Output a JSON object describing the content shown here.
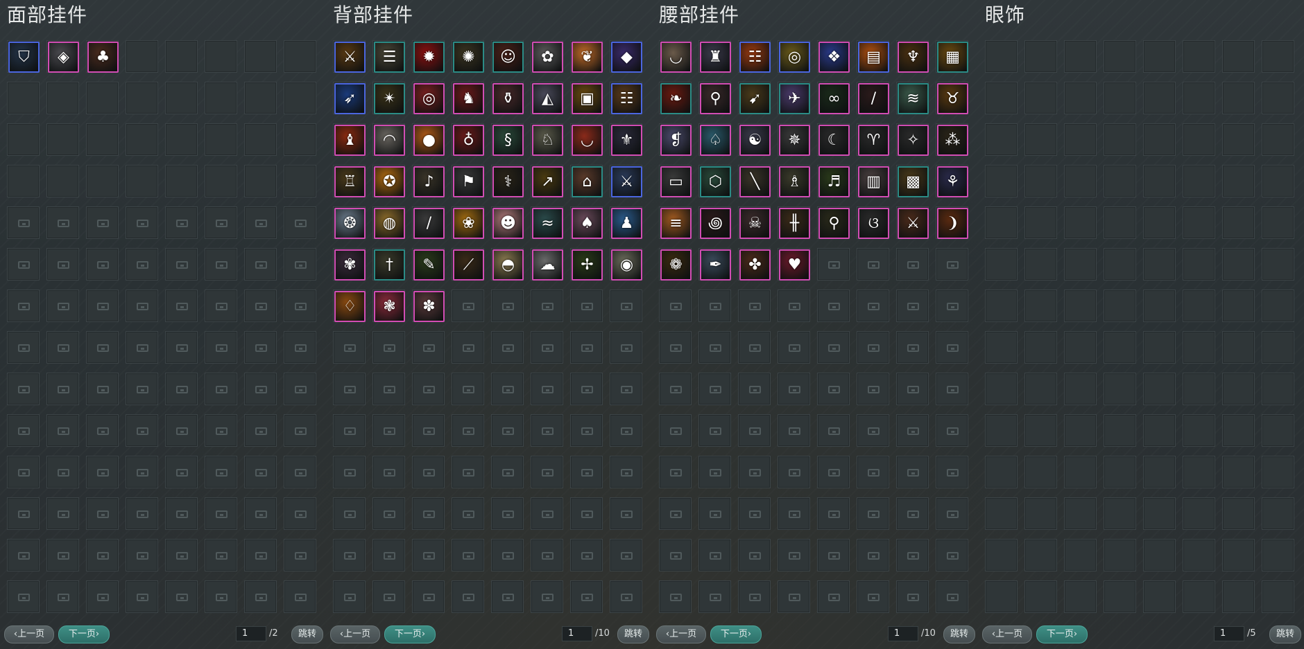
{
  "panels": [
    {
      "title": "面部挂件",
      "icons": [
        {
          "name": "face-mask-icon",
          "glyph": "⛉",
          "bg": "#243448",
          "border": "blue"
        },
        {
          "name": "face-shield-icon",
          "glyph": "◈",
          "bg": "#4a4a4f",
          "border": "pink"
        },
        {
          "name": "face-mushroom-icon",
          "glyph": "♣",
          "bg": "#4a2b1e",
          "border": "pink"
        }
      ],
      "empty_unlocked": 29,
      "prev_label": "上一页",
      "next_label": "下一页",
      "page_value": "1",
      "page_total": "/2",
      "jump_label": "跳转"
    },
    {
      "title": "背部挂件",
      "icons": [
        {
          "name": "golden-sword-icon",
          "glyph": "⚔",
          "bg": "#5a3a12",
          "border": "blue"
        },
        {
          "name": "scroll-icon",
          "glyph": "☰",
          "bg": "#4a4636",
          "border": "teal"
        },
        {
          "name": "red-flame-icon",
          "glyph": "✹",
          "bg": "#8a1010",
          "border": "teal"
        },
        {
          "name": "golden-web-icon",
          "glyph": "✺",
          "bg": "#3a3420",
          "border": "teal"
        },
        {
          "name": "doll-icon",
          "glyph": "☺",
          "bg": "#4a2018",
          "border": "teal"
        },
        {
          "name": "white-flower-icon",
          "glyph": "✿",
          "bg": "#5a5a5a",
          "border": "pink"
        },
        {
          "name": "butterfly-icon",
          "glyph": "❦",
          "bg": "#c06a28",
          "border": "pink"
        },
        {
          "name": "purple-crystal-icon",
          "glyph": "◆",
          "bg": "#3a2a6a",
          "border": "blue"
        },
        {
          "name": "blue-spear-icon",
          "glyph": "➶",
          "bg": "#1a3a7a",
          "border": "blue"
        },
        {
          "name": "bronze-wheel-icon",
          "glyph": "✴",
          "bg": "#3a3218",
          "border": "teal"
        },
        {
          "name": "red-lantern-icon",
          "glyph": "◎",
          "bg": "#7a2020",
          "border": "pink"
        },
        {
          "name": "red-bird-icon",
          "glyph": "♞",
          "bg": "#6a1a1a",
          "border": "pink"
        },
        {
          "name": "jade-vase-icon",
          "glyph": "⚱",
          "bg": "#4a2a2a",
          "border": "pink"
        },
        {
          "name": "silver-wolf-icon",
          "glyph": "◭",
          "bg": "#4a4a5a",
          "border": "pink"
        },
        {
          "name": "golden-chest-icon",
          "glyph": "▣",
          "bg": "#6a4a10",
          "border": "pink"
        },
        {
          "name": "books-icon",
          "glyph": "☷",
          "bg": "#5a3a1a",
          "border": "blue"
        },
        {
          "name": "parrot-icon",
          "glyph": "♝",
          "bg": "#8a2a10",
          "border": "pink"
        },
        {
          "name": "white-fan-icon",
          "glyph": "◠",
          "bg": "#6a6660",
          "border": "pink"
        },
        {
          "name": "orange-orb-icon",
          "glyph": "●",
          "bg": "#b05a18",
          "border": "pink"
        },
        {
          "name": "red-gourd-icon",
          "glyph": "♁",
          "bg": "#6a1a1a",
          "border": "pink"
        },
        {
          "name": "green-dragon-icon",
          "glyph": "§",
          "bg": "#2a4a3a",
          "border": "pink"
        },
        {
          "name": "white-bird-icon",
          "glyph": "♘",
          "bg": "#5a5a4a",
          "border": "pink"
        },
        {
          "name": "red-fan-icon",
          "glyph": "◡",
          "bg": "#8a2a1a",
          "border": "pink"
        },
        {
          "name": "silver-wings-icon",
          "glyph": "⚜",
          "bg": "#2a2a3a",
          "border": "pink"
        },
        {
          "name": "bird-cage-icon",
          "glyph": "♖",
          "bg": "#4a3a1a",
          "border": "pink"
        },
        {
          "name": "golden-star-icon",
          "glyph": "✪",
          "bg": "#b06a10",
          "border": "pink"
        },
        {
          "name": "wind-chime-icon",
          "glyph": "♪",
          "bg": "#3a3428",
          "border": "pink"
        },
        {
          "name": "white-banner-icon",
          "glyph": "⚑",
          "bg": "#3a3a3a",
          "border": "pink"
        },
        {
          "name": "golden-staff-icon",
          "glyph": "⚕",
          "bg": "#2a2418",
          "border": "pink"
        },
        {
          "name": "golden-spear-icon",
          "glyph": "↗",
          "bg": "#4a3a10",
          "border": "pink"
        },
        {
          "name": "pavilion-icon",
          "glyph": "⌂",
          "bg": "#5a3a2a",
          "border": "teal"
        },
        {
          "name": "blue-sword-icon",
          "glyph": "⚔",
          "bg": "#2a3a5a",
          "border": "blue"
        },
        {
          "name": "silver-pendant-icon",
          "glyph": "❂",
          "bg": "#6a7a8a",
          "border": "pink"
        },
        {
          "name": "golden-ring-icon",
          "glyph": "◍",
          "bg": "#8a6a2a",
          "border": "pink"
        },
        {
          "name": "silver-blade-icon",
          "glyph": "/",
          "bg": "#3a3a3a",
          "border": "pink"
        },
        {
          "name": "golden-lotus-icon",
          "glyph": "❀",
          "bg": "#a06a10",
          "border": "pink"
        },
        {
          "name": "pink-girl-icon",
          "glyph": "☻",
          "bg": "#b07a7a",
          "border": "pink"
        },
        {
          "name": "teal-fish-icon",
          "glyph": "≈",
          "bg": "#2a4a4a",
          "border": "pink"
        },
        {
          "name": "pink-crane-icon",
          "glyph": "♠",
          "bg": "#6a4a5a",
          "border": "pink"
        },
        {
          "name": "penguin-icon",
          "glyph": "♟",
          "bg": "#2a5a8a",
          "border": "pink"
        },
        {
          "name": "pink-blossom-icon",
          "glyph": "✾",
          "bg": "#3a2a3a",
          "border": "pink"
        },
        {
          "name": "golden-scepter-icon",
          "glyph": "†",
          "bg": "#3a3a2a",
          "border": "teal"
        },
        {
          "name": "talisman-icon",
          "glyph": "✎",
          "bg": "#2a3a1a",
          "border": "pink"
        },
        {
          "name": "golden-rod-icon",
          "glyph": "⟋",
          "bg": "#3a2a18",
          "border": "pink"
        },
        {
          "name": "straw-hat-icon",
          "glyph": "◓",
          "bg": "#8a7a50",
          "border": "pink"
        },
        {
          "name": "silver-cloud-icon",
          "glyph": "☁",
          "bg": "#6a6a6a",
          "border": "pink"
        },
        {
          "name": "golden-branch-icon",
          "glyph": "✢",
          "bg": "#2a3a18",
          "border": "pink"
        },
        {
          "name": "golden-mirror-icon",
          "glyph": "◉",
          "bg": "#6a6a5a",
          "border": "pink"
        },
        {
          "name": "amber-bottle-icon",
          "glyph": "♢",
          "bg": "#8a4a10",
          "border": "pink"
        },
        {
          "name": "ruby-orb-icon",
          "glyph": "❃",
          "bg": "#8a2a3a",
          "border": "pink"
        },
        {
          "name": "pink-fan-icon",
          "glyph": "✽",
          "bg": "#5a3a3a",
          "border": "pink"
        }
      ],
      "empty_unlocked": 0,
      "prev_label": "上一页",
      "next_label": "下一页",
      "page_value": "1",
      "page_total": "/10",
      "jump_label": "跳转"
    },
    {
      "title": "腰部挂件",
      "icons": [
        {
          "name": "paper-fan-icon",
          "glyph": "◡",
          "bg": "#6a5a4a",
          "border": "pink"
        },
        {
          "name": "silver-armor-icon",
          "glyph": "♜",
          "bg": "#3a3a4a",
          "border": "pink"
        },
        {
          "name": "firecracker-icon",
          "glyph": "☷",
          "bg": "#9a3a10",
          "border": "blue"
        },
        {
          "name": "gold-coins-icon",
          "glyph": "◎",
          "bg": "#6a5a1a",
          "border": "blue"
        },
        {
          "name": "blue-wing-icon",
          "glyph": "❖",
          "bg": "#2a3a8a",
          "border": "pink"
        },
        {
          "name": "red-drum-icon",
          "glyph": "▤",
          "bg": "#b05010",
          "border": "blue"
        },
        {
          "name": "golden-candle-icon",
          "glyph": "♆",
          "bg": "#4a3010",
          "border": "pink"
        },
        {
          "name": "golden-basket-icon",
          "glyph": "▦",
          "bg": "#6a4a10",
          "border": "teal"
        },
        {
          "name": "red-cape-icon",
          "glyph": "❧",
          "bg": "#6a1a10",
          "border": "teal"
        },
        {
          "name": "silver-hook-icon",
          "glyph": "⚲",
          "bg": "#3a2a2a",
          "border": "pink"
        },
        {
          "name": "bronze-horn-icon",
          "glyph": "➹",
          "bg": "#4a3a1a",
          "border": "teal"
        },
        {
          "name": "purple-blade-icon",
          "glyph": "✈",
          "bg": "#4a3a6a",
          "border": "teal"
        },
        {
          "name": "green-beads-icon",
          "glyph": "∞",
          "bg": "#1a2a1a",
          "border": "pink"
        },
        {
          "name": "red-dagger-icon",
          "glyph": "/",
          "bg": "#2a1a1a",
          "border": "pink"
        },
        {
          "name": "jade-scroll-icon",
          "glyph": "≋",
          "bg": "#3a5a4a",
          "border": "teal"
        },
        {
          "name": "golden-dragon-icon",
          "glyph": "♉",
          "bg": "#5a3a10",
          "border": "pink"
        },
        {
          "name": "purple-rabbit-icon",
          "glyph": "❡",
          "bg": "#4a4a6a",
          "border": "pink"
        },
        {
          "name": "teal-pouch-icon",
          "glyph": "♤",
          "bg": "#2a5a6a",
          "border": "pink"
        },
        {
          "name": "silver-mask-icon",
          "glyph": "☯",
          "bg": "#3a3a4a",
          "border": "pink"
        },
        {
          "name": "dark-pearl-icon",
          "glyph": "✵",
          "bg": "#3a3a3a",
          "border": "pink"
        },
        {
          "name": "moon-pendant-icon",
          "glyph": "☾",
          "bg": "#2a2a2a",
          "border": "pink"
        },
        {
          "name": "golden-goat-icon",
          "glyph": "♈",
          "bg": "#2a2a2a",
          "border": "pink"
        },
        {
          "name": "white-feather-icon",
          "glyph": "✧",
          "bg": "#2a2a2a",
          "border": "pink"
        },
        {
          "name": "golden-tassel-icon",
          "glyph": "⁂",
          "bg": "#2a2418",
          "border": "pink"
        },
        {
          "name": "white-tag-icon",
          "glyph": "▭",
          "bg": "#3a3a3a",
          "border": "pink"
        },
        {
          "name": "green-lantern-icon",
          "glyph": "⬡",
          "bg": "#2a4a3a",
          "border": "teal"
        },
        {
          "name": "bronze-stick-icon",
          "glyph": "╲",
          "bg": "#3a3428",
          "border": "pink"
        },
        {
          "name": "stone-lamp-icon",
          "glyph": "♗",
          "bg": "#3a3a2a",
          "border": "pink"
        },
        {
          "name": "green-wind-chime-icon",
          "glyph": "♬",
          "bg": "#2a3a1a",
          "border": "pink"
        },
        {
          "name": "gray-drum-icon",
          "glyph": "▥",
          "bg": "#4a4040",
          "border": "pink"
        },
        {
          "name": "red-basket-icon",
          "glyph": "▩",
          "bg": "#4a3a1a",
          "border": "teal"
        },
        {
          "name": "blue-charm-icon",
          "glyph": "⚘",
          "bg": "#2a2a4a",
          "border": "pink"
        },
        {
          "name": "orange-cloth-icon",
          "glyph": "≡",
          "bg": "#a05a20",
          "border": "pink"
        },
        {
          "name": "black-swirl-icon",
          "glyph": "꩜",
          "bg": "#2a1a1a",
          "border": "pink"
        },
        {
          "name": "skull-bell-icon",
          "glyph": "☠",
          "bg": "#3a2a2a",
          "border": "pink"
        },
        {
          "name": "wooden-rack-icon",
          "glyph": "╫",
          "bg": "#3a2a18",
          "border": "pink"
        },
        {
          "name": "hanging-charm-icon",
          "glyph": "⚲",
          "bg": "#2a2a1a",
          "border": "pink"
        },
        {
          "name": "silver-snake-icon",
          "glyph": "ଓ",
          "bg": "#2a2a2a",
          "border": "pink"
        },
        {
          "name": "red-sword-icon",
          "glyph": "⚔",
          "bg": "#4a2a1a",
          "border": "pink"
        },
        {
          "name": "orange-shrimp-icon",
          "glyph": "❩",
          "bg": "#5a2a10",
          "border": "pink"
        },
        {
          "name": "golden-wreath-icon",
          "glyph": "❁",
          "bg": "#3a2a10",
          "border": "pink"
        },
        {
          "name": "silver-quill-icon",
          "glyph": "✒",
          "bg": "#3a4a5a",
          "border": "pink"
        },
        {
          "name": "red-bells-icon",
          "glyph": "✤",
          "bg": "#4a2a1a",
          "border": "pink"
        },
        {
          "name": "red-heart-icon",
          "glyph": "♥",
          "bg": "#6a1a2a",
          "border": "pink"
        }
      ],
      "empty_unlocked": 0,
      "prev_label": "上一页",
      "next_label": "下一页",
      "page_value": "1",
      "page_total": "/10",
      "jump_label": "跳转"
    },
    {
      "title": "眼饰",
      "icons": [],
      "empty_unlocked": 112,
      "prev_label": "上一页",
      "next_label": "下一页",
      "page_value": "1",
      "page_total": "/5",
      "jump_label": "跳转"
    }
  ]
}
